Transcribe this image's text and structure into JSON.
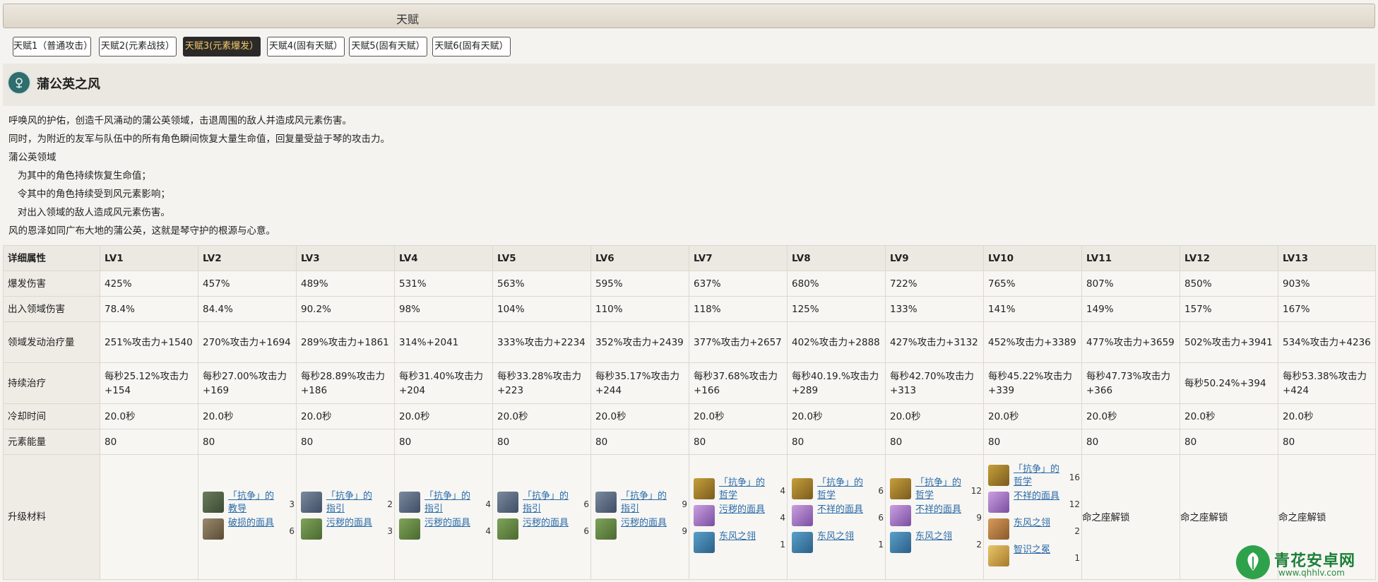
{
  "title": "天赋",
  "tabs": [
    {
      "label": "天赋1（普通攻击）",
      "active": false
    },
    {
      "label": "天赋2(元素战技）",
      "active": false
    },
    {
      "label": "天赋3(元素爆发）",
      "active": true
    },
    {
      "label": "天赋4(固有天赋）",
      "active": false
    },
    {
      "label": "天赋5(固有天赋）",
      "active": false
    },
    {
      "label": "天赋6(固有天赋）",
      "active": false
    }
  ],
  "skill": {
    "icon": "dandelion-emblem-icon",
    "name": "蒲公英之风",
    "description": [
      "呼唤风的护佑，创造千风涌动的蒲公英领域，击退周围的敌人并造成风元素伤害。",
      "同时，为附近的友军与队伍中的所有角色瞬间恢复大量生命值，回复量受益于琴的攻击力。",
      "蒲公英领域",
      "   为其中的角色持续恢复生命值；",
      "   令其中的角色持续受到风元素影响；",
      "   对出入领域的敌人造成风元素伤害。",
      "风的恩泽如同广布大地的蒲公英，这就是琴守护的根源与心意。"
    ]
  },
  "table": {
    "header": [
      "详细属性",
      "LV1",
      "LV2",
      "LV3",
      "LV4",
      "LV5",
      "LV6",
      "LV7",
      "LV8",
      "LV9",
      "LV10",
      "LV11",
      "LV12",
      "LV13"
    ],
    "rows": [
      {
        "label": "爆发伤害",
        "cells": [
          "425%",
          "457%",
          "489%",
          "531%",
          "563%",
          "595%",
          "637%",
          "680%",
          "722%",
          "765%",
          "807%",
          "850%",
          "903%"
        ]
      },
      {
        "label": "出入领域伤害",
        "cells": [
          "78.4%",
          "84.4%",
          "90.2%",
          "98%",
          "104%",
          "110%",
          "118%",
          "125%",
          "133%",
          "141%",
          "149%",
          "157%",
          "167%"
        ]
      },
      {
        "label": "领域发动治疗量",
        "cells": [
          "251%攻击力+1540",
          "270%攻击力+1694",
          "289%攻击力+1861",
          "314%+2041",
          "333%攻击力+2234",
          "352%攻击力+2439",
          "377%攻击力+2657",
          "402%攻击力+2888",
          "427%攻击力+3132",
          "452%攻击力+3389",
          "477%攻击力+3659",
          "502%攻击力+3941",
          "534%攻击力+4236"
        ]
      },
      {
        "label": "持续治疗",
        "cells": [
          "每秒25.12%攻击力+154",
          "每秒27.00%攻击力+169",
          "每秒28.89%攻击力+186",
          "每秒31.40%攻击力+204",
          "每秒33.28%攻击力+223",
          "每秒35.17%攻击力+244",
          "每秒37.68%攻击力+166",
          "每秒40.19.%攻击力+289",
          "每秒42.70%攻击力+313",
          "每秒45.22%攻击力+339",
          "每秒47.73%攻击力+366",
          "每秒50.24%+394",
          "每秒53.38%攻击力+424"
        ]
      },
      {
        "label": "冷却时间",
        "cells": [
          "20.0秒",
          "20.0秒",
          "20.0秒",
          "20.0秒",
          "20.0秒",
          "20.0秒",
          "20.0秒",
          "20.0秒",
          "20.0秒",
          "20.0秒",
          "20.0秒",
          "20.0秒",
          "20.0秒"
        ]
      },
      {
        "label": "元素能量",
        "cells": [
          "80",
          "80",
          "80",
          "80",
          "80",
          "80",
          "80",
          "80",
          "80",
          "80",
          "80",
          "80",
          "80"
        ]
      }
    ],
    "materials_label": "升级材料",
    "materials": [
      [],
      [
        {
          "name": "「抗争」的教导",
          "count": "3",
          "icon": "c1"
        },
        {
          "name": "破损的面具",
          "count": "6",
          "icon": "c5"
        }
      ],
      [
        {
          "name": "「抗争」的指引",
          "count": "2",
          "icon": "c2"
        },
        {
          "name": "污秽的面具",
          "count": "3",
          "icon": "c6"
        }
      ],
      [
        {
          "name": "「抗争」的指引",
          "count": "4",
          "icon": "c2"
        },
        {
          "name": "污秽的面具",
          "count": "4",
          "icon": "c6"
        }
      ],
      [
        {
          "name": "「抗争」的指引",
          "count": "6",
          "icon": "c2"
        },
        {
          "name": "污秽的面具",
          "count": "6",
          "icon": "c6"
        }
      ],
      [
        {
          "name": "「抗争」的指引",
          "count": "9",
          "icon": "c2"
        },
        {
          "name": "污秽的面具",
          "count": "9",
          "icon": "c6"
        }
      ],
      [
        {
          "name": "「抗争」的哲学",
          "count": "4",
          "icon": "c3"
        },
        {
          "name": "污秽的面具",
          "count": "4",
          "icon": "c7"
        },
        {
          "name": "东风之翎",
          "count": "1",
          "icon": "c4"
        }
      ],
      [
        {
          "name": "「抗争」的哲学",
          "count": "6",
          "icon": "c3"
        },
        {
          "name": "不祥的面具",
          "count": "6",
          "icon": "c7"
        },
        {
          "name": "东风之翎",
          "count": "1",
          "icon": "c4"
        }
      ],
      [
        {
          "name": "「抗争」的哲学",
          "count": "12",
          "icon": "c3"
        },
        {
          "name": "不祥的面具",
          "count": "9",
          "icon": "c7"
        },
        {
          "name": "东风之翎",
          "count": "2",
          "icon": "c4"
        }
      ],
      [
        {
          "name": "「抗争」的哲学",
          "count": "16",
          "icon": "c3"
        },
        {
          "name": "不祥的面具",
          "count": "12",
          "icon": "c7"
        },
        {
          "name": "东风之翎",
          "count": "2",
          "icon": "c8"
        },
        {
          "name": "智识之冕",
          "count": "1",
          "icon": "c9"
        }
      ],
      [
        {
          "name": "命之座解锁",
          "text": true
        }
      ],
      [
        {
          "name": "命之座解锁",
          "text": true
        }
      ],
      [
        {
          "name": "命之座解锁",
          "text": true
        }
      ]
    ]
  },
  "watermark": {
    "text": "青花安卓网",
    "url": "www.qhhlv.com",
    "icon": "qinghua-logo-icon"
  },
  "colors": {
    "accent": "#2b2a28",
    "active_text": "#f2c96a",
    "link": "#2a6aa8",
    "watermark": "#1c7f38"
  }
}
